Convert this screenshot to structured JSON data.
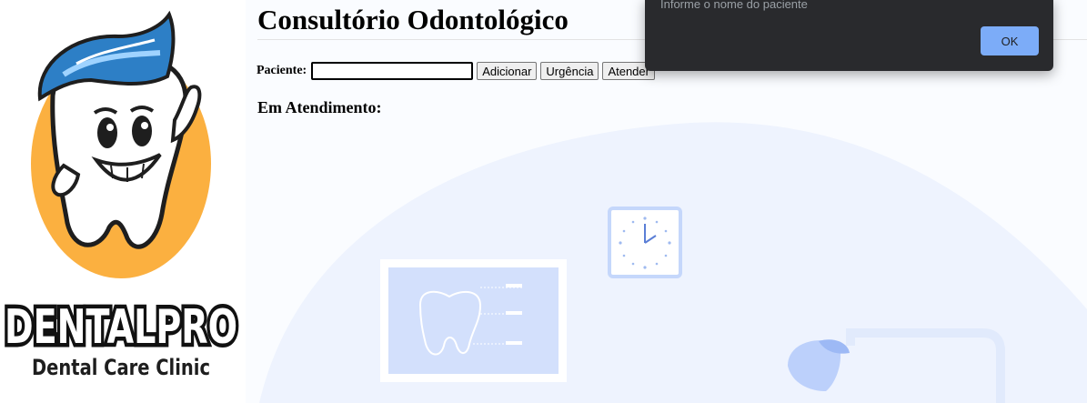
{
  "page": {
    "title": "Consultório Odontológico",
    "patient_label": "Paciente:",
    "patient_value": "",
    "add_button": "Adicionar",
    "urgent_button": "Urgência",
    "attend_button": "Atender",
    "in_service_heading": "Em Atendimento:"
  },
  "logo": {
    "brand_name": "DENTALPRO",
    "tagline": "Dental Care Clinic"
  },
  "dialog": {
    "message": "Informe o nome do paciente",
    "ok_label": "OK"
  },
  "colors": {
    "accent_blue": "#7cacf8",
    "dialog_bg": "#292a2d",
    "illustration_bg": "#eef3fe",
    "logo_orange": "#fbb040"
  }
}
